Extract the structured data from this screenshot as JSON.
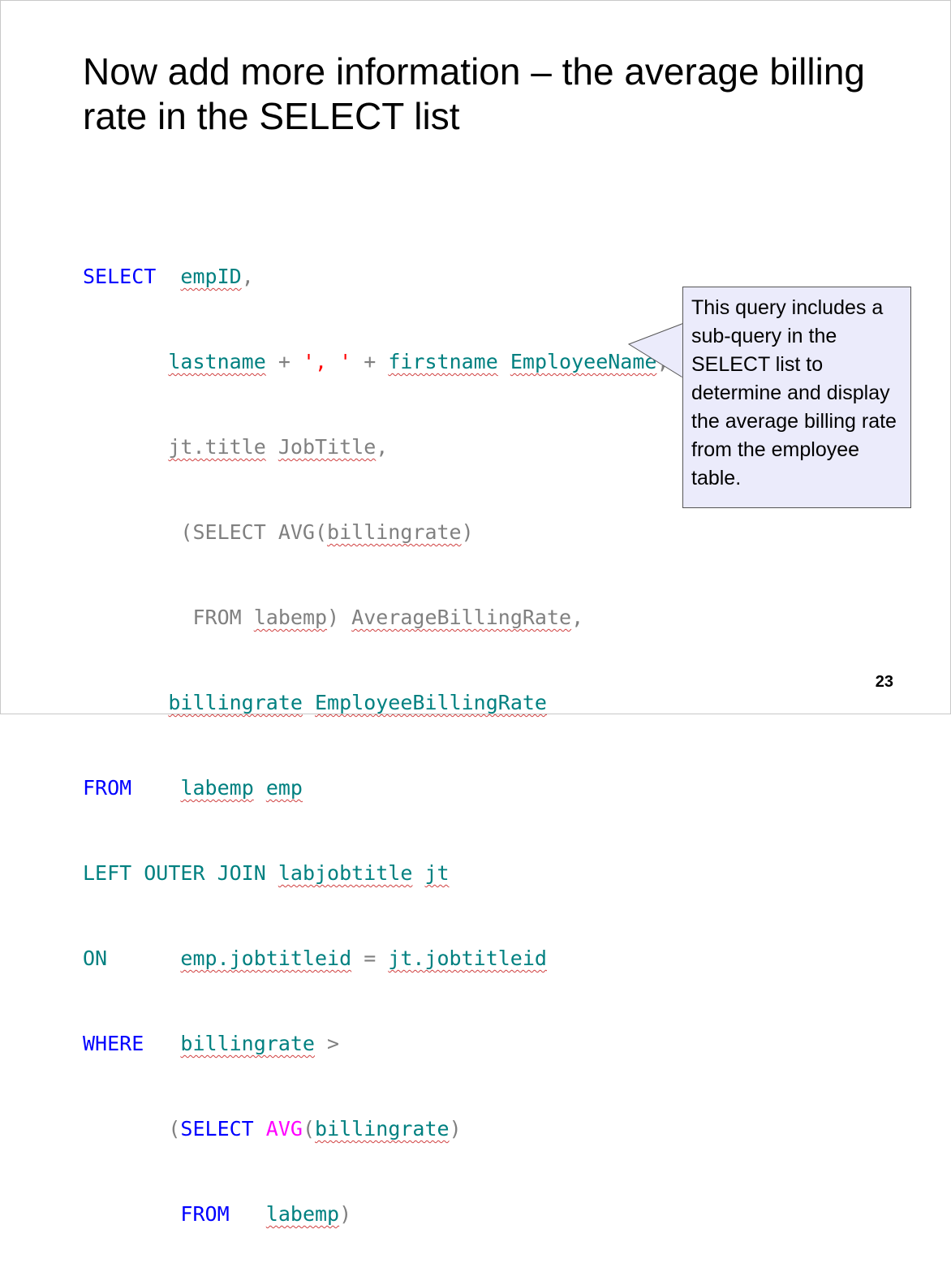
{
  "slide": {
    "title": "Now add more information – the average billing rate in the SELECT list",
    "page_number": "23"
  },
  "code": {
    "l1": {
      "kw": "SELECT",
      "sp": "  ",
      "a": "empID",
      "b": ","
    },
    "l2": {
      "indent": "       ",
      "a": "lastname",
      "b": " + ",
      "c": "', '",
      "d": " + ",
      "e": "firstname",
      "f": " ",
      "g": "EmployeeName",
      "h": ","
    },
    "l3": {
      "indent": "       ",
      "a": "jt.title",
      "b": " ",
      "c": "JobTitle",
      "d": ","
    },
    "l4": {
      "indent": "        ",
      "a": "(SELECT AVG(",
      "b": "billingrate",
      "c": ")"
    },
    "l5": {
      "indent": "         ",
      "a": "FROM ",
      "b": "labemp",
      "c": ") ",
      "d": "AverageBillingRate",
      "e": ","
    },
    "l6": {
      "indent": "       ",
      "a": "billingrate",
      "b": " ",
      "c": "EmployeeBillingRate"
    },
    "l7": {
      "kw": "FROM",
      "sp": "    ",
      "a": "labemp",
      "b": " ",
      "c": "emp"
    },
    "l8": {
      "kw": "LEFT OUTER JOIN",
      "sp": " ",
      "a": "labjobtitle",
      "b": " ",
      "c": "jt"
    },
    "l9": {
      "kw": "ON",
      "sp": "      ",
      "a": "emp.jobtitleid",
      "b": " = ",
      "c": "jt.jobtitleid"
    },
    "l10": {
      "kw": "WHERE",
      "sp": "   ",
      "a": "billingrate",
      "b": " >"
    },
    "l11": {
      "indent": "       ",
      "a": "(",
      "b": "SELECT",
      "c": " ",
      "d": "AVG",
      "e": "(",
      "f": "billingrate",
      "g": ")"
    },
    "l12": {
      "indent": "        ",
      "a": "FROM",
      "b": "   ",
      "c": "labemp",
      "d": ")"
    }
  },
  "callout": {
    "text": "This query includes a sub-query in the SELECT list to determine and display the average billing rate from the employee table."
  },
  "colors": {
    "keyword": "#0000ff",
    "identifier": "#008080",
    "string": "#ff0000",
    "function": "#ff00ff",
    "operator": "#808080",
    "callout_bg": "#ebebfb"
  }
}
